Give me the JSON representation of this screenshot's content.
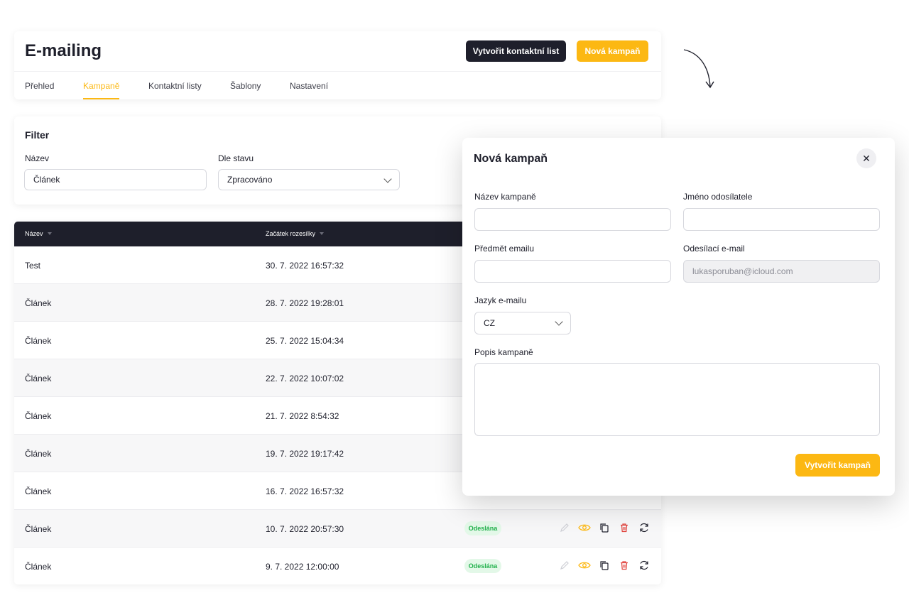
{
  "header": {
    "title": "E-mailing",
    "create_contact_list_label": "Vytvořit kontaktní list",
    "new_campaign_label": "Nová kampaň",
    "tabs": [
      {
        "label": "Přehled",
        "active": false
      },
      {
        "label": "Kampaně",
        "active": true
      },
      {
        "label": "Kontaktní listy",
        "active": false
      },
      {
        "label": "Šablony",
        "active": false
      },
      {
        "label": "Nastavení",
        "active": false
      }
    ]
  },
  "filter": {
    "title": "Filter",
    "name_label": "Název",
    "name_value": "Článek",
    "status_label": "Dle stavu",
    "status_value": "Zpracováno"
  },
  "table": {
    "columns": [
      "Název",
      "Začátek rozesílky"
    ],
    "rows": [
      {
        "name": "Test",
        "start": "30. 7. 2022  16:57:32",
        "status": ""
      },
      {
        "name": "Článek",
        "start": "28. 7. 2022  19:28:01",
        "status": ""
      },
      {
        "name": "Článek",
        "start": "25. 7. 2022  15:04:34",
        "status": ""
      },
      {
        "name": "Článek",
        "start": "22. 7. 2022  10:07:02",
        "status": ""
      },
      {
        "name": "Článek",
        "start": "21. 7. 2022  8:54:32",
        "status": ""
      },
      {
        "name": "Článek",
        "start": "19. 7. 2022  19:17:42",
        "status": ""
      },
      {
        "name": "Článek",
        "start": "16. 7. 2022  16:57:32",
        "status": ""
      },
      {
        "name": "Článek",
        "start": "10. 7. 2022  20:57:30",
        "status": "Odeslána"
      },
      {
        "name": "Článek",
        "start": "9. 7. 2022  12:00:00",
        "status": "Odeslána"
      }
    ],
    "row_icons": [
      "pencil-icon",
      "eye-icon",
      "copy-icon",
      "trash-icon",
      "refresh-icon"
    ]
  },
  "modal": {
    "title": "Nová kampaň",
    "campaign_name_label": "Název kampaně",
    "campaign_name_value": "",
    "sender_name_label": "Jméno odosílatele",
    "sender_name_value": "",
    "subject_label": "Předmět emailu",
    "subject_value": "",
    "sender_email_label": "Odesílací e-mail",
    "sender_email_value": "lukasporuban@icloud.com",
    "language_label": "Jazyk e-mailu",
    "language_value": "CZ",
    "description_label": "Popis kampaně",
    "submit_label": "Vytvořit kampaň"
  },
  "colors": {
    "accent": "#fcb813",
    "dark": "#1e1f2b",
    "success_bg": "#e3f8e8",
    "success_text": "#22b14c",
    "danger": "#e0403a"
  }
}
